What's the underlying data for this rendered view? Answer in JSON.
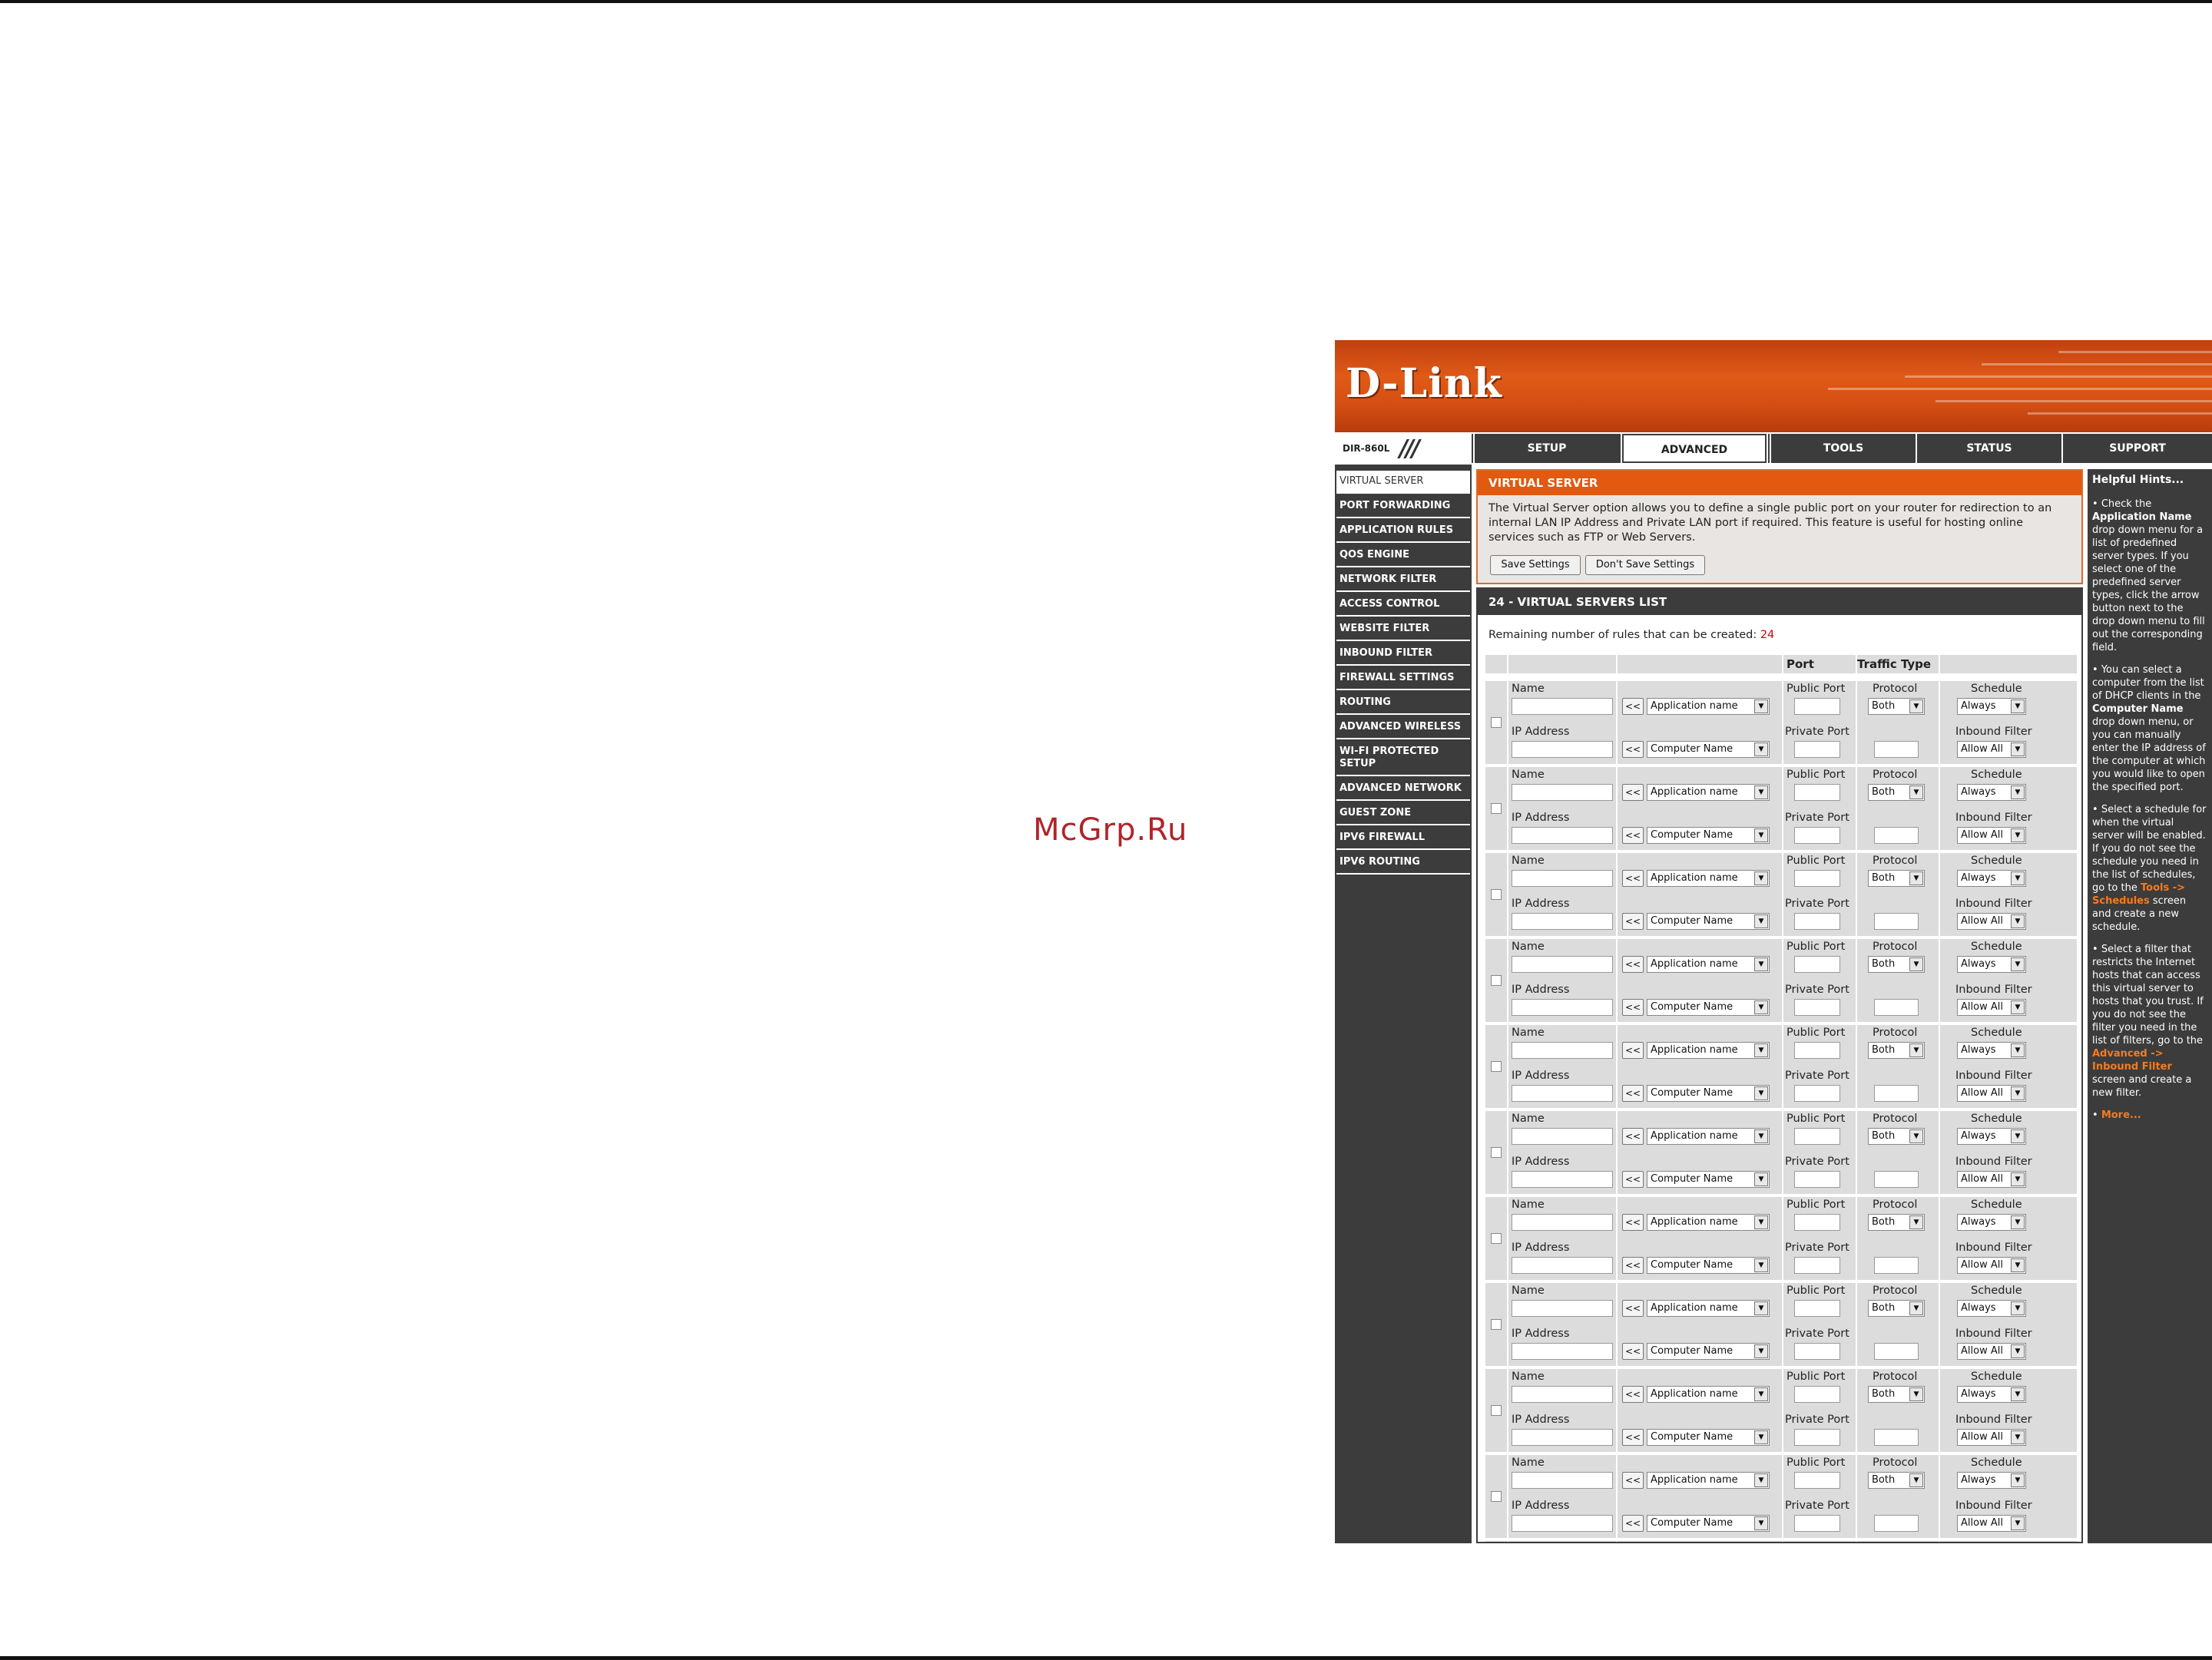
{
  "watermark": "McGrp.Ru",
  "brand": {
    "logo": "D-Link",
    "model": "DIR-860L",
    "accent": "#e2590f",
    "dark": "#3c3c3c"
  },
  "tabs": [
    {
      "label": "SETUP"
    },
    {
      "label": "ADVANCED"
    },
    {
      "label": "TOOLS"
    },
    {
      "label": "STATUS"
    },
    {
      "label": "SUPPORT"
    }
  ],
  "sidebar": {
    "items": [
      {
        "label": "VIRTUAL SERVER"
      },
      {
        "label": "PORT FORWARDING"
      },
      {
        "label": "APPLICATION RULES"
      },
      {
        "label": "QOS ENGINE"
      },
      {
        "label": "NETWORK FILTER"
      },
      {
        "label": "ACCESS CONTROL"
      },
      {
        "label": "WEBSITE FILTER"
      },
      {
        "label": "INBOUND FILTER"
      },
      {
        "label": "FIREWALL SETTINGS"
      },
      {
        "label": "ROUTING"
      },
      {
        "label": "ADVANCED WIRELESS"
      },
      {
        "label": "WI-FI PROTECTED SETUP"
      },
      {
        "label": "ADVANCED NETWORK"
      },
      {
        "label": "GUEST ZONE"
      },
      {
        "label": "IPV6 FIREWALL"
      },
      {
        "label": "IPV6 ROUTING"
      }
    ]
  },
  "virtual_server": {
    "title": "VIRTUAL SERVER",
    "description": "The Virtual Server option allows you to define a single public port on your router for redirection to an internal LAN IP Address and Private LAN port if required. This feature is useful for hosting online services such as FTP or Web Servers.",
    "save_label": "Save Settings",
    "dont_save_label": "Don't Save Settings"
  },
  "list": {
    "title": "24 - VIRTUAL SERVERS LIST",
    "remaining_label": "Remaining number of rules that can be created:",
    "remaining_count": "24",
    "header_port": "Port",
    "header_traffic": "Traffic Type",
    "labels": {
      "name": "Name",
      "ip": "IP Address",
      "public_port": "Public Port",
      "private_port": "Private Port",
      "protocol": "Protocol",
      "schedule": "Schedule",
      "inbound": "Inbound Filter",
      "arrow": "<<",
      "app_select": "Application name",
      "computer_select": "Computer Name",
      "protocol_value": "Both",
      "schedule_value": "Always",
      "inbound_value": "Allow All"
    }
  },
  "hints": {
    "title": "Helpful Hints...",
    "hint1_a": "Check the ",
    "hint1_b": "Application Name",
    "hint1_c": " drop down menu for a list of predefined server types. If you select one of the predefined server types, click the arrow button next to the drop down menu to fill out the corresponding field.",
    "hint2_a": "You can select a computer from the list of DHCP clients in the ",
    "hint2_b": "Computer Name",
    "hint2_c": " drop down menu, or you can manually enter the IP address of the computer at which you would like to open the specified port.",
    "hint3_a": "Select a schedule for when the virtual server will be enabled. If you do not see the schedule you need in the list of schedules, go to the ",
    "hint3_b": "Tools -> Schedules",
    "hint3_c": " screen and create a new schedule.",
    "hint4_a": "Select a filter that restricts the Internet hosts that can access this virtual server to hosts that you trust. If you do not see the filter you need in the list of filters, go to the ",
    "hint4_b": "Advanced -> Inbound Filter",
    "hint4_c": " screen and create a new filter.",
    "more": "More..."
  }
}
